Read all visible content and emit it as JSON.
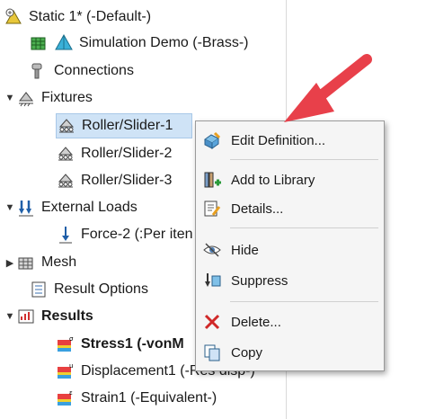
{
  "tree": {
    "root": "Static 1* (-Default-)",
    "part": "Simulation Demo (-Brass-)",
    "connections": "Connections",
    "fixtures": "Fixtures",
    "fixture_items": [
      "Roller/Slider-1",
      "Roller/Slider-2",
      "Roller/Slider-3"
    ],
    "external_loads": "External Loads",
    "force": "Force-2 (:Per iten",
    "mesh": "Mesh",
    "result_options": "Result Options",
    "results": "Results",
    "result_items": [
      "Stress1 (-vonM",
      "Displacement1 (-Res disp-)",
      "Strain1 (-Equivalent-)"
    ]
  },
  "context_menu": {
    "edit_definition": "Edit Definition...",
    "add_to_library": "Add to Library",
    "details": "Details...",
    "hide": "Hide",
    "suppress": "Suppress",
    "delete": "Delete...",
    "copy": "Copy"
  },
  "colors": {
    "selection": "#cfe3f6",
    "arrow": "#e8404a",
    "menu_bg": "#f5f5f5"
  }
}
